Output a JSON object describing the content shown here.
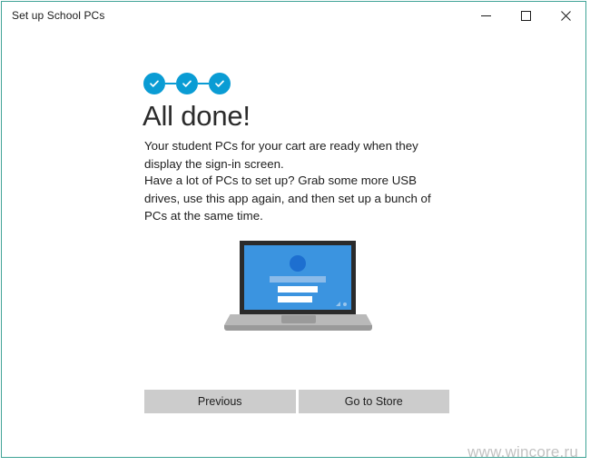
{
  "window": {
    "title": "Set up School PCs",
    "border_color": "#3fa396",
    "controls": [
      {
        "name": "minimize",
        "label": "Minimize"
      },
      {
        "name": "maximize",
        "label": "Maximize"
      },
      {
        "name": "close",
        "label": "Close"
      }
    ]
  },
  "progress": {
    "accent_color": "#0a9cd4",
    "steps": [
      {
        "state": "complete",
        "icon": "check-icon"
      },
      {
        "state": "complete",
        "icon": "check-icon"
      },
      {
        "state": "complete",
        "icon": "check-icon"
      }
    ]
  },
  "main": {
    "heading": "All done!",
    "paragraph_1": "Your student PCs for your cart are ready when they display the sign-in screen.",
    "paragraph_2": "Have a lot of PCs to set up? Grab some more USB drives, use this app again, and then set up a bunch of PCs at the same time."
  },
  "illustration": {
    "name": "laptop-sign-in-illustration",
    "screen_color": "#3b94e0",
    "bezel_color": "#2b2b2b",
    "body_color": "#b9b9b9"
  },
  "footer": {
    "previous_label": "Previous",
    "go_to_store_label": "Go to Store"
  },
  "watermark": {
    "text": "www.wincore.ru"
  }
}
